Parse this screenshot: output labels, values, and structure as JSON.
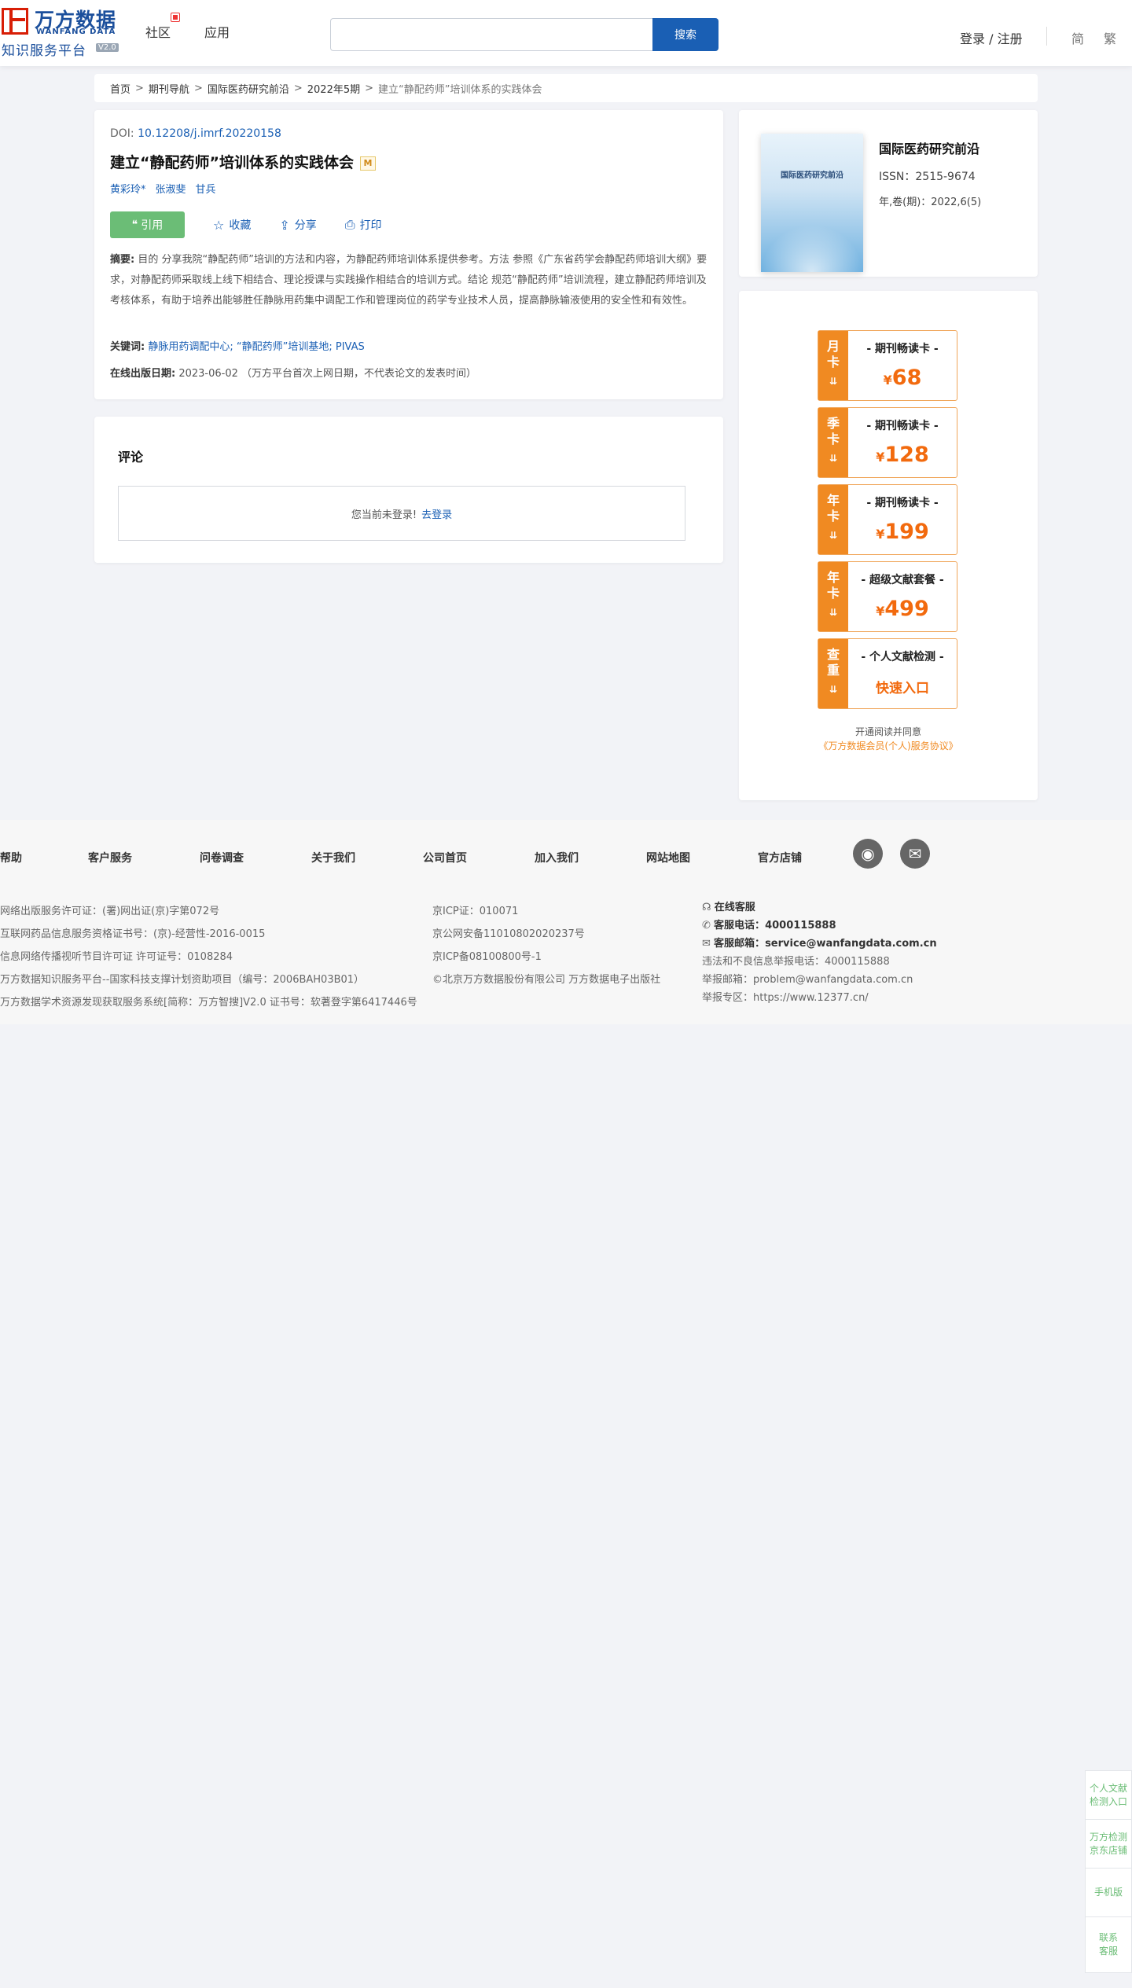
{
  "header": {
    "logo_cn": "万方数据",
    "logo_en": "WANFANG DATA",
    "logo_sub": "知识服务平台",
    "logo_version": "V2.0",
    "nav": [
      "社区",
      "应用"
    ],
    "search_placeholder": "",
    "search_button": "搜索",
    "login": "登录 / 注册",
    "lang_simplified": "简",
    "lang_traditional": "繁"
  },
  "breadcrumb": [
    "首页",
    "期刊导航",
    "国际医药研究前沿",
    "2022年5期",
    "建立“静配药师”培训体系的实践体会"
  ],
  "article": {
    "doi_label": "DOI:",
    "doi": "10.12208/j.imrf.20220158",
    "title": "建立“静配药师”培训体系的实践体会",
    "badge": "M",
    "authors": [
      "黄彩玲*",
      "张淑斐",
      "甘兵"
    ],
    "actions": {
      "cite": "引用",
      "favorite": "收藏",
      "share": "分享",
      "print": "打印"
    },
    "abstract_label": "摘要:",
    "abstract": "目的 分享我院“静配药师”培训的方法和内容，为静配药师培训体系提供参考。方法 参照《广东省药学会静配药师培训大纲》要求，对静配药师采取线上线下相结合、理论授课与实践操作相结合的培训方式。结论 规范“静配药师”培训流程，建立静配药师培训及考核体系，有助于培养出能够胜任静脉用药集中调配工作和管理岗位的药学专业技术人员，提高静脉输液使用的安全性和有效性。",
    "keywords_label": "关键词:",
    "keywords": [
      "静脉用药调配中心;",
      "“静配药师”培训基地;",
      "PIVAS"
    ],
    "pubdate_label": "在线出版日期:",
    "pubdate": "2023-06-02",
    "pubdate_note": "（万方平台首次上网日期，不代表论文的发表时间）"
  },
  "comments": {
    "title": "评论",
    "not_logged": "您当前未登录!",
    "login_link": "去登录"
  },
  "journal": {
    "cover_text": "国际医药研究前沿",
    "name": "国际医药研究前沿",
    "issn": "ISSN：2515-9674",
    "volume": "年,卷(期)：2022,6(5)"
  },
  "membership": [
    {
      "side": [
        "月",
        "卡"
      ],
      "title": "- 期刊畅读卡 -",
      "currency": "¥",
      "price": "68"
    },
    {
      "side": [
        "季",
        "卡"
      ],
      "title": "- 期刊畅读卡 -",
      "currency": "¥",
      "price": "128"
    },
    {
      "side": [
        "年",
        "卡"
      ],
      "title": "- 期刊畅读卡 -",
      "currency": "¥",
      "price": "199"
    },
    {
      "side": [
        "年",
        "卡"
      ],
      "title": "- 超级文献套餐 -",
      "currency": "¥",
      "price": "499"
    },
    {
      "side": [
        "查",
        "重"
      ],
      "title": "- 个人文献检测 -",
      "quick": "快速入口"
    }
  ],
  "agreement": {
    "line1": "开通阅读并同意",
    "link": "《万方数据会员(个人)服务协议》"
  },
  "footer": {
    "links": [
      "帮助",
      "客户服务",
      "问卷调查",
      "关于我们",
      "公司首页",
      "加入我们",
      "网站地图",
      "官方店铺"
    ],
    "col1": [
      "网络出版服务许可证：(署)网出证(京)字第072号",
      "互联网药品信息服务资格证书号：(京)-经营性-2016-0015",
      "信息网络传播视听节目许可证 许可证号：0108284",
      "万方数据知识服务平台--国家科技支撑计划资助项目（编号：2006BAH03B01）",
      "万方数据学术资源发现获取服务系统[简称：万方智搜]V2.0 证书号：软著登字第6417446号"
    ],
    "col2": [
      "京ICP证：010071",
      "京公网安备11010802020237号",
      "京ICP备08100800号-1",
      "©北京万方数据股份有限公司 万方数据电子出版社"
    ],
    "online_service": "在线客服",
    "phone_label": "客服电话：",
    "phone": "4000115888",
    "email_label": "客服邮箱：",
    "email": "service@wanfangdata.com.cn",
    "report_phone": "违法和不良信息举报电话：4000115888",
    "report_email": "举报邮箱：problem@wanfangdata.com.cn",
    "report_zone": "举报专区：https://www.12377.cn/"
  },
  "floating": [
    "个人文献检测入口",
    "万方检测京东店铺",
    "手机版",
    "联系客服"
  ],
  "colors": {
    "brand_blue": "#1a5fb4",
    "cite_green": "#6bbd76",
    "member_orange": "#f08a22",
    "price_orange": "#f26a0e"
  }
}
